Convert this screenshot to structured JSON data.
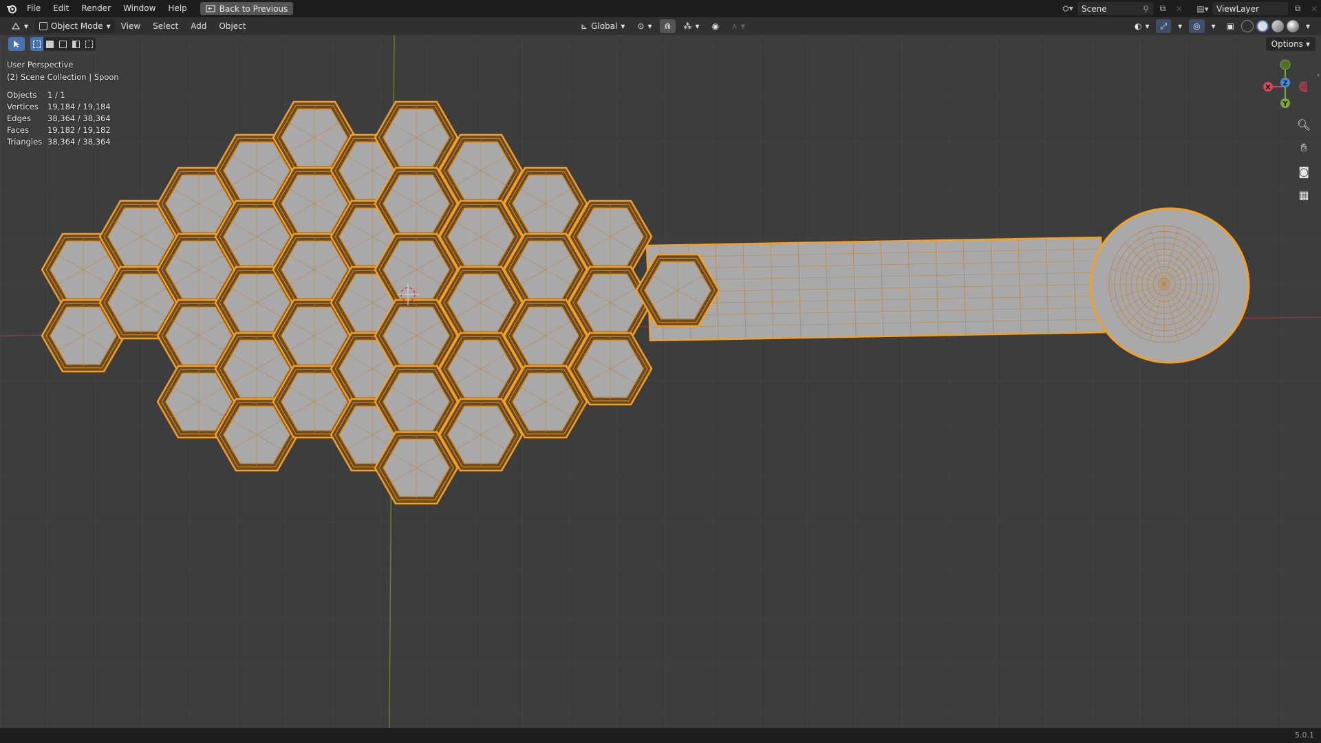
{
  "topbar": {
    "menus": [
      "File",
      "Edit",
      "Render",
      "Window",
      "Help"
    ],
    "back_label": "Back to Previous",
    "scene_name": "Scene",
    "view_layer": "ViewLayer"
  },
  "header": {
    "mode": "Object Mode",
    "menus": [
      "View",
      "Select",
      "Add",
      "Object"
    ],
    "transform_orientation": "Global",
    "options_label": "Options"
  },
  "overlay": {
    "view_name": "User Perspective",
    "collection_line": "(2) Scene Collection | Spoon"
  },
  "stats": [
    {
      "label": "Objects",
      "value": "1 / 1"
    },
    {
      "label": "Vertices",
      "value": "19,184 / 19,184"
    },
    {
      "label": "Edges",
      "value": "38,364 / 38,364"
    },
    {
      "label": "Faces",
      "value": "19,182 / 19,182"
    },
    {
      "label": "Triangles",
      "value": "38,364 / 38,364"
    }
  ],
  "gizmo": {
    "x": "X",
    "y": "Y",
    "z": "Z"
  },
  "status": {
    "version": "5.0.1"
  },
  "colors": {
    "selection": "#f5a023",
    "mesh_fill": "#a9a9a9",
    "axis_x": "#d44a5a",
    "axis_y": "#7aa83a",
    "axis_z": "#3f8fdd",
    "active_tool": "#4772b3"
  }
}
